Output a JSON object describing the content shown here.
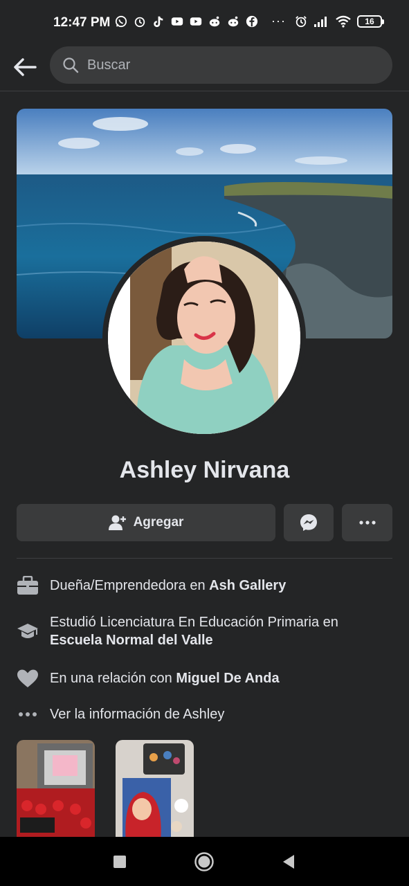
{
  "status_bar": {
    "time": "12:47 PM",
    "left_icons": [
      "whatsapp-icon",
      "alarm-icon",
      "tiktok-icon",
      "youtube-icon",
      "youtube-icon",
      "reddit-icon",
      "reddit-icon",
      "facebook-icon"
    ],
    "more": "···",
    "battery": "16"
  },
  "search": {
    "placeholder": "Buscar"
  },
  "profile": {
    "name": "Ashley Nirvana"
  },
  "actions": {
    "add_label": "Agregar"
  },
  "info": {
    "work_prefix": "Dueña/Emprendedora en ",
    "work_place": "Ash Gallery",
    "study_prefix": "Estudió Licenciatura En Educación Primaria en ",
    "study_place": "Escuela Normal del Valle",
    "relationship_prefix": "En una relación con ",
    "relationship_person": "Miguel De Anda",
    "see_info": "Ver la información de Ashley"
  },
  "colors": {
    "background": "#242526",
    "button": "#3a3b3c",
    "text": "#e4e6eb",
    "muted": "#b0b3b8"
  }
}
